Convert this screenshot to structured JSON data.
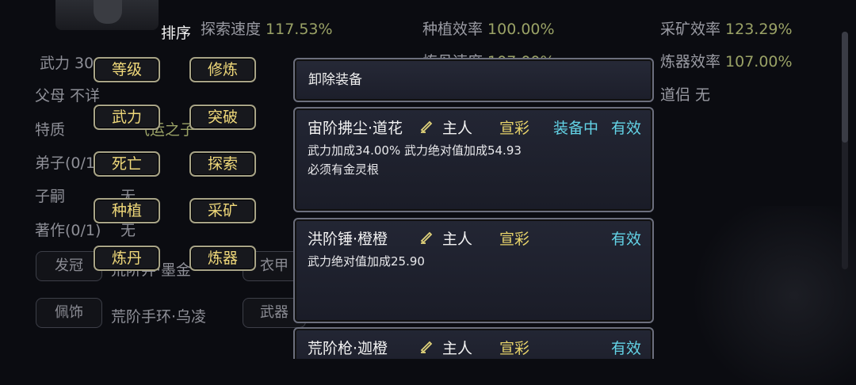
{
  "header": {
    "sort_title": "排序",
    "stats": [
      {
        "label": "探索速度",
        "value": "117.53%"
      },
      {
        "label": "种植效率",
        "value": "100.00%"
      },
      {
        "label": "采矿效率",
        "value": "123.29%"
      },
      {
        "label": "炼丹速度",
        "value": "107.00%"
      },
      {
        "label": "炼器效率",
        "value": "107.00%"
      },
      {
        "label": "道侣",
        "value": "无"
      }
    ]
  },
  "profile": {
    "wuli": "武力 30/40",
    "parents": "父母 不详",
    "traits_label": "特质",
    "trait_value": "气运之子",
    "disciples": "弟子(0/1)",
    "heirs": "子嗣",
    "heirs_value": "无",
    "works": "著作(0/1)",
    "works_value": "无"
  },
  "equipment_slots": [
    {
      "label": "发冠",
      "item": "荒阶笄·墨金"
    },
    {
      "label": "衣甲",
      "item": ""
    },
    {
      "label": "佩饰",
      "item": "荒阶手环·乌凌"
    },
    {
      "label": "武器",
      "item": ""
    }
  ],
  "sort_buttons": [
    "等级",
    "修炼",
    "武力",
    "突破",
    "死亡",
    "探索",
    "种植",
    "采矿",
    "炼丹",
    "炼器"
  ],
  "panel": {
    "unequip_label": "卸除装备",
    "items": [
      {
        "name": "宙阶拂尘·道花",
        "owner": "主人",
        "color": "宣彩",
        "status": "装备中",
        "valid": "有效",
        "desc1": "武力加成34.00% 武力绝对值加成54.93",
        "desc2": "必须有金灵根"
      },
      {
        "name": "洪阶锤·橙橙",
        "owner": "主人",
        "color": "宣彩",
        "status": "",
        "valid": "有效",
        "desc1": "武力绝对值加成25.90",
        "desc2": ""
      },
      {
        "name": "荒阶枪·迦橙",
        "owner": "主人",
        "color": "宣彩",
        "status": "",
        "valid": "有效",
        "desc1": "",
        "desc2": ""
      }
    ]
  }
}
